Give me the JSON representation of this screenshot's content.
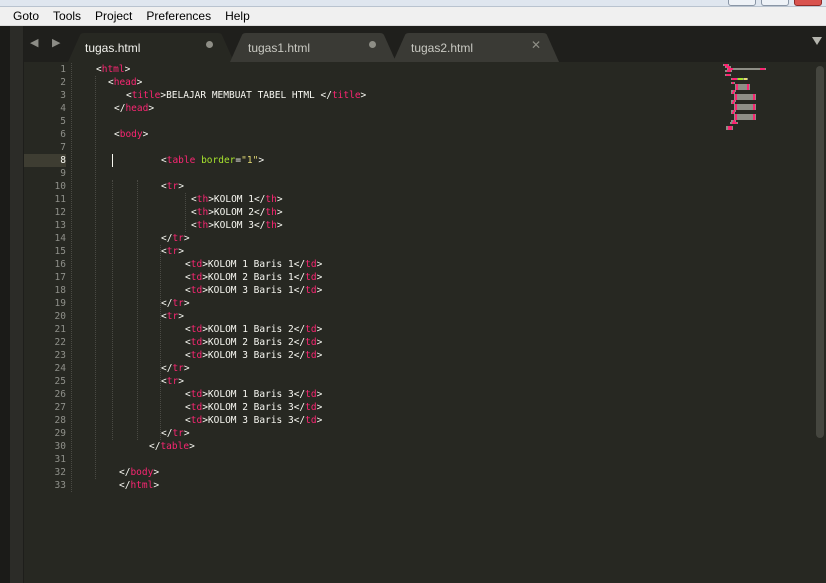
{
  "menu": [
    "Goto",
    "Tools",
    "Project",
    "Preferences",
    "Help"
  ],
  "tabs": [
    {
      "name": "tugas.html",
      "active": true,
      "modified": true
    },
    {
      "name": "tugas1.html",
      "active": false,
      "modified": true
    },
    {
      "name": "tugas2.html",
      "active": false,
      "modified": false
    }
  ],
  "tab_nav": "◀ ▶",
  "current_line": 8,
  "line_numbers": [
    "1",
    "2",
    "3",
    "4",
    "5",
    "6",
    "7",
    "8",
    "9",
    "10",
    "11",
    "12",
    "13",
    "14",
    "15",
    "16",
    "17",
    "18",
    "19",
    "20",
    "21",
    "22",
    "23",
    "24",
    "25",
    "26",
    "27",
    "28",
    "29",
    "30",
    "31",
    "32",
    "33"
  ],
  "code_lines": [
    [
      [
        "p",
        "<"
      ],
      [
        "t",
        "html"
      ],
      [
        "p",
        ">"
      ]
    ],
    [
      [
        "p",
        "<"
      ],
      [
        "t",
        "head"
      ],
      [
        "p",
        ">"
      ]
    ],
    [
      [
        "p",
        "<"
      ],
      [
        "t",
        "title"
      ],
      [
        "p",
        ">BELAJAR MEMBUAT TABEL HTML </"
      ],
      [
        "t",
        "title"
      ],
      [
        "p",
        ">"
      ]
    ],
    [
      [
        "p",
        "</"
      ],
      [
        "t",
        "head"
      ],
      [
        "p",
        ">"
      ]
    ],
    [],
    [
      [
        "p",
        "<"
      ],
      [
        "t",
        "body"
      ],
      [
        "p",
        ">"
      ]
    ],
    [],
    [
      [
        "p",
        "<"
      ],
      [
        "t",
        "table"
      ],
      [
        "p",
        " "
      ],
      [
        "a",
        "border"
      ],
      [
        "p",
        "="
      ],
      [
        "s",
        "\"1\""
      ],
      [
        "p",
        ">"
      ]
    ],
    [],
    [
      [
        "p",
        "<"
      ],
      [
        "t",
        "tr"
      ],
      [
        "p",
        ">"
      ]
    ],
    [
      [
        "p",
        "<"
      ],
      [
        "t",
        "th"
      ],
      [
        "p",
        ">KOLOM 1</"
      ],
      [
        "t",
        "th"
      ],
      [
        "p",
        ">"
      ]
    ],
    [
      [
        "p",
        "<"
      ],
      [
        "t",
        "th"
      ],
      [
        "p",
        ">KOLOM 2</"
      ],
      [
        "t",
        "th"
      ],
      [
        "p",
        ">"
      ]
    ],
    [
      [
        "p",
        "<"
      ],
      [
        "t",
        "th"
      ],
      [
        "p",
        ">KOLOM 3</"
      ],
      [
        "t",
        "th"
      ],
      [
        "p",
        ">"
      ]
    ],
    [
      [
        "p",
        "</"
      ],
      [
        "t",
        "tr"
      ],
      [
        "p",
        ">"
      ]
    ],
    [
      [
        "p",
        "<"
      ],
      [
        "t",
        "tr"
      ],
      [
        "p",
        ">"
      ]
    ],
    [
      [
        "p",
        "<"
      ],
      [
        "t",
        "td"
      ],
      [
        "p",
        ">KOLOM 1 Baris 1</"
      ],
      [
        "t",
        "td"
      ],
      [
        "p",
        ">"
      ]
    ],
    [
      [
        "p",
        "<"
      ],
      [
        "t",
        "td"
      ],
      [
        "p",
        ">KOLOM 2 Baris 1</"
      ],
      [
        "t",
        "td"
      ],
      [
        "p",
        ">"
      ]
    ],
    [
      [
        "p",
        "<"
      ],
      [
        "t",
        "td"
      ],
      [
        "p",
        ">KOLOM 3 Baris 1</"
      ],
      [
        "t",
        "td"
      ],
      [
        "p",
        ">"
      ]
    ],
    [
      [
        "p",
        "</"
      ],
      [
        "t",
        "tr"
      ],
      [
        "p",
        ">"
      ]
    ],
    [
      [
        "p",
        "<"
      ],
      [
        "t",
        "tr"
      ],
      [
        "p",
        ">"
      ]
    ],
    [
      [
        "p",
        "<"
      ],
      [
        "t",
        "td"
      ],
      [
        "p",
        ">KOLOM 1 Baris 2</"
      ],
      [
        "t",
        "td"
      ],
      [
        "p",
        ">"
      ]
    ],
    [
      [
        "p",
        "<"
      ],
      [
        "t",
        "td"
      ],
      [
        "p",
        ">KOLOM 2 Baris 2</"
      ],
      [
        "t",
        "td"
      ],
      [
        "p",
        ">"
      ]
    ],
    [
      [
        "p",
        "<"
      ],
      [
        "t",
        "td"
      ],
      [
        "p",
        ">KOLOM 3 Baris 2</"
      ],
      [
        "t",
        "td"
      ],
      [
        "p",
        ">"
      ]
    ],
    [
      [
        "p",
        "</"
      ],
      [
        "t",
        "tr"
      ],
      [
        "p",
        ">"
      ]
    ],
    [
      [
        "p",
        "<"
      ],
      [
        "t",
        "tr"
      ],
      [
        "p",
        ">"
      ]
    ],
    [
      [
        "p",
        "<"
      ],
      [
        "t",
        "td"
      ],
      [
        "p",
        ">KOLOM 1 Baris 3</"
      ],
      [
        "t",
        "td"
      ],
      [
        "p",
        ">"
      ]
    ],
    [
      [
        "p",
        "<"
      ],
      [
        "t",
        "td"
      ],
      [
        "p",
        ">KOLOM 2 Baris 3</"
      ],
      [
        "t",
        "td"
      ],
      [
        "p",
        ">"
      ]
    ],
    [
      [
        "p",
        "<"
      ],
      [
        "t",
        "td"
      ],
      [
        "p",
        ">KOLOM 3 Baris 3</"
      ],
      [
        "t",
        "td"
      ],
      [
        "p",
        ">"
      ]
    ],
    [
      [
        "p",
        "</"
      ],
      [
        "t",
        "tr"
      ],
      [
        "p",
        ">"
      ]
    ],
    [
      [
        "p",
        "</"
      ],
      [
        "t",
        "table"
      ],
      [
        "p",
        ">"
      ]
    ],
    [],
    [
      [
        "p",
        "</"
      ],
      [
        "t",
        "body"
      ],
      [
        "p",
        ">"
      ]
    ],
    [
      [
        "p",
        "</"
      ],
      [
        "t",
        "html"
      ],
      [
        "p",
        ">"
      ]
    ]
  ],
  "colors": {
    "background": "#272822",
    "tag": "#f92672",
    "attribute": "#a6e22e",
    "string": "#e6db74",
    "text": "#f8f8f2",
    "gutter_text": "#8f908a"
  }
}
